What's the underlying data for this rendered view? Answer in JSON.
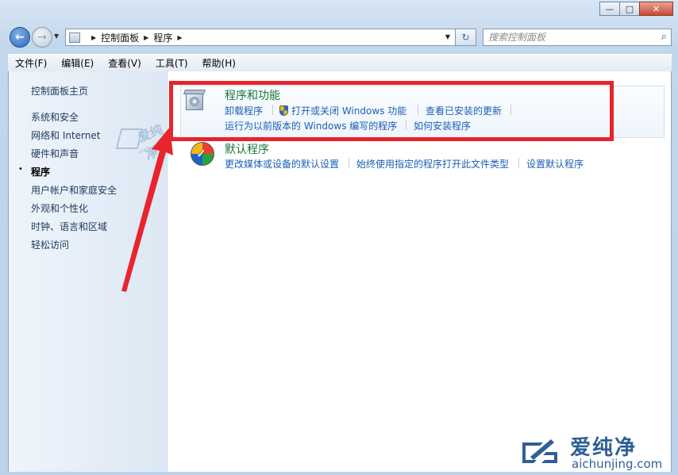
{
  "window": {
    "minimize": "—",
    "maximize": "□",
    "close": "✕"
  },
  "nav": {
    "back": "←",
    "forward": "→",
    "history_dropdown": "▼"
  },
  "address": {
    "crumbs": [
      "控制面板",
      "程序"
    ],
    "separator": "▶",
    "dropdown": "▼",
    "refresh": "↻"
  },
  "search": {
    "placeholder": "搜索控制面板"
  },
  "menubar": [
    "文件(F)",
    "编辑(E)",
    "查看(V)",
    "工具(T)",
    "帮助(H)"
  ],
  "sidebar": {
    "items": [
      "控制面板主页",
      "系统和安全",
      "网络和 Internet",
      "硬件和声音",
      "程序",
      "用户帐户和家庭安全",
      "外观和个性化",
      "时钟、语言和区域",
      "轻松访问"
    ],
    "current_index": 4,
    "bullet": "•"
  },
  "sections": [
    {
      "title": "程序和功能",
      "links_row1": [
        "卸载程序",
        "打开或关闭 Windows 功能",
        "查看已安装的更新"
      ],
      "links_row2": [
        "运行为以前版本的 Windows 编写的程序",
        "如何安装程序"
      ]
    },
    {
      "title": "默认程序",
      "links_row1": [
        "更改媒体或设备的默认设置",
        "始终使用指定的程序打开此文件类型",
        "设置默认程序"
      ]
    }
  ],
  "watermark": {
    "cn": "爱纯净",
    "en": "aichunjing.com"
  },
  "colors": {
    "link": "#1a5fb4",
    "section_title": "#16773a",
    "highlight": "#e8242c"
  }
}
